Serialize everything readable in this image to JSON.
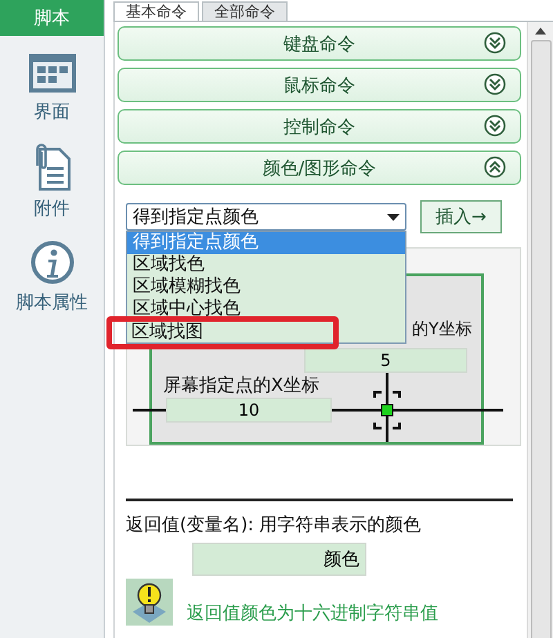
{
  "sidebar": {
    "title": "脚本",
    "items": [
      {
        "kind": "grid",
        "label": "界面"
      },
      {
        "kind": "clip",
        "label": "附件"
      },
      {
        "kind": "info",
        "label": "脚本属性"
      }
    ]
  },
  "tabs": [
    {
      "label": "基本命令",
      "selected": true
    },
    {
      "label": "全部命令",
      "selected": false
    }
  ],
  "sections": [
    {
      "title": "键盘命令",
      "expanded": false
    },
    {
      "title": "鼠标命令",
      "expanded": false
    },
    {
      "title": "控制命令",
      "expanded": false
    },
    {
      "title": "颜色/图形命令",
      "expanded": true
    }
  ],
  "command_select": {
    "value": "得到指定点颜色",
    "options": [
      {
        "label": "得到指定点颜色",
        "selected": true,
        "highlighted": false
      },
      {
        "label": "区域找色",
        "selected": false,
        "highlighted": false
      },
      {
        "label": "区域模糊找色",
        "selected": false,
        "highlighted": false
      },
      {
        "label": "区域中心找色",
        "selected": false,
        "highlighted": false
      },
      {
        "label": "区域找图",
        "selected": false,
        "highlighted": true
      }
    ]
  },
  "insert_button": "插入→",
  "y_label": "的Y坐标",
  "y_value": "5",
  "x_label": "屏幕指定点的X坐标",
  "x_value": "10",
  "return_label": "返回值(变量名): 用字符串表示的颜色",
  "return_value": "颜色",
  "tip": "返回值颜色为十六进制字符串值"
}
